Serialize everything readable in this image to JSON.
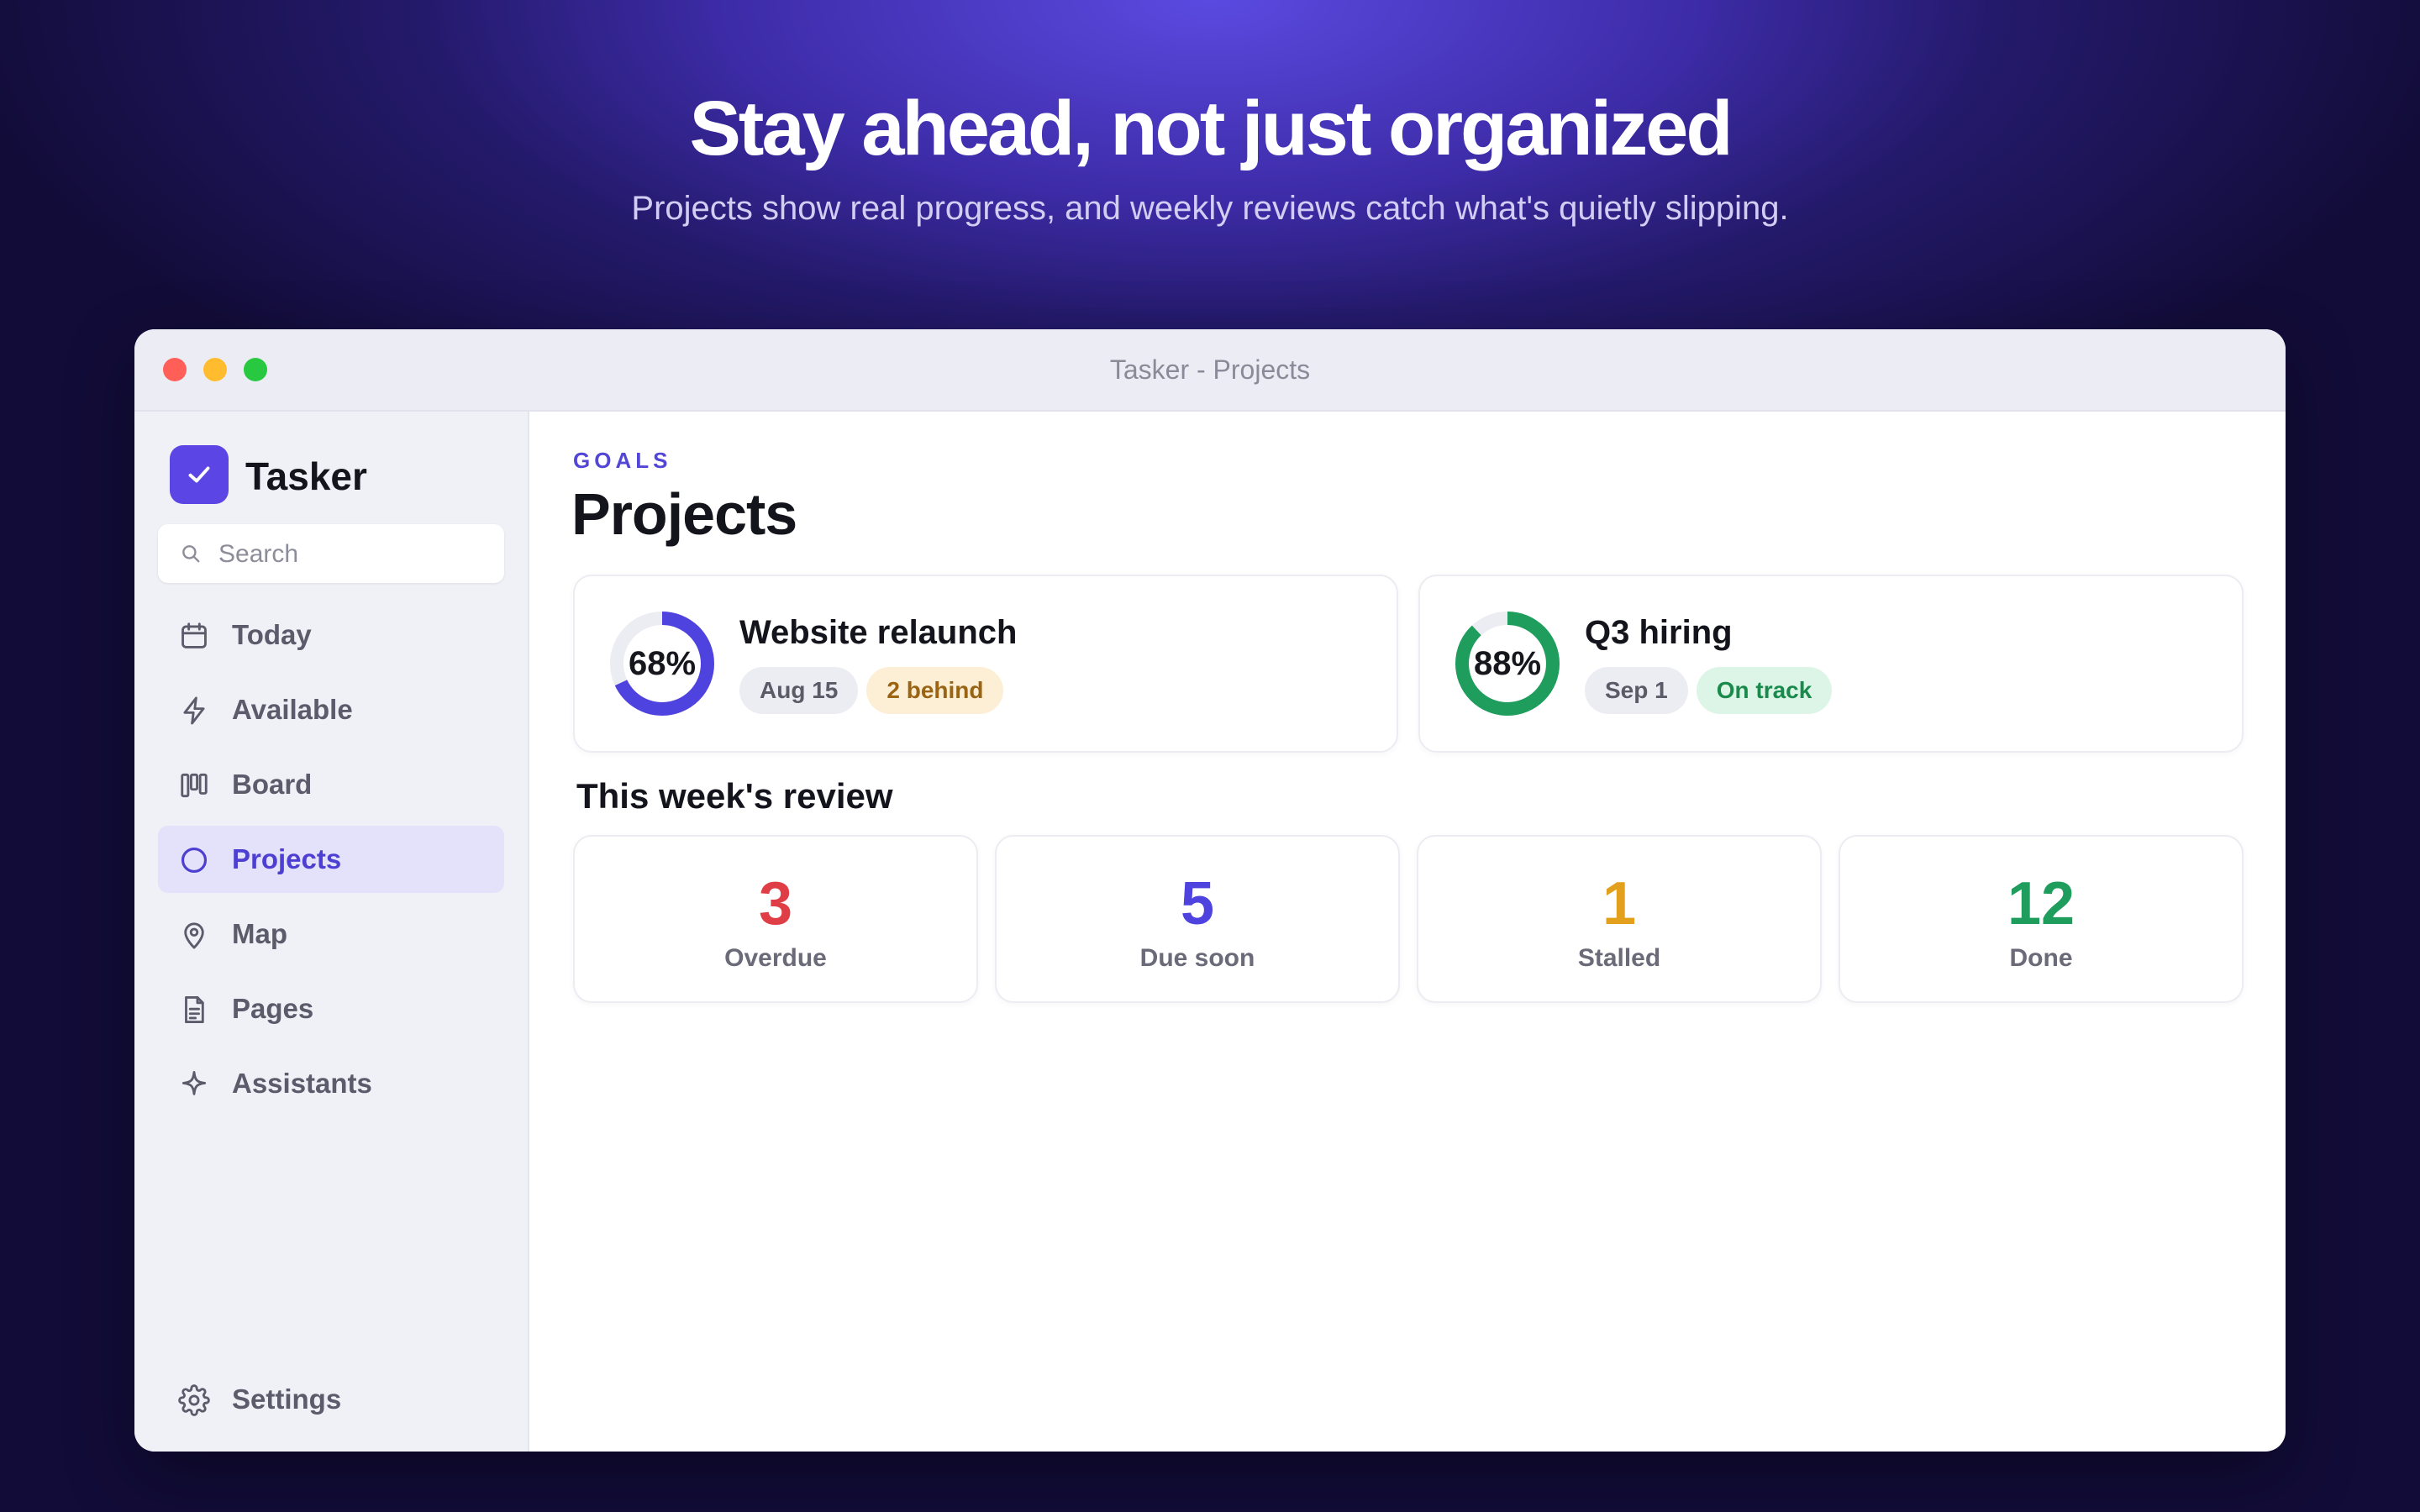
{
  "hero": {
    "title": "Stay ahead, not just organized",
    "subtitle": "Projects show real progress, and weekly reviews catch what's quietly slipping."
  },
  "window": {
    "title": "Tasker - Projects"
  },
  "sidebar": {
    "brand": "Tasker",
    "search_placeholder": "Search",
    "items": [
      {
        "label": "Today",
        "icon": "calendar-icon",
        "active": false
      },
      {
        "label": "Available",
        "icon": "lightning-icon",
        "active": false
      },
      {
        "label": "Board",
        "icon": "board-columns-icon",
        "active": false
      },
      {
        "label": "Projects",
        "icon": "circle-icon",
        "active": true
      },
      {
        "label": "Map",
        "icon": "map-pin-icon",
        "active": false
      },
      {
        "label": "Pages",
        "icon": "document-icon",
        "active": false
      },
      {
        "label": "Assistants",
        "icon": "sparkle-icon",
        "active": false
      }
    ],
    "settings_label": "Settings"
  },
  "main": {
    "eyebrow": "GOALS",
    "title": "Projects",
    "projects": [
      {
        "name": "Website relaunch",
        "progress_label": "68%",
        "progress": 0.68,
        "date": "Aug 15",
        "status": "2 behind",
        "ring_color": "#4f43e0"
      },
      {
        "name": "Q3 hiring",
        "progress_label": "88%",
        "progress": 0.88,
        "date": "Sep 1",
        "status": "On track",
        "ring_color": "#1f9d5c"
      }
    ],
    "review_title": "This week's review",
    "stats": [
      {
        "value": "3",
        "label": "Overdue",
        "color": "#e03e46"
      },
      {
        "value": "5",
        "label": "Due soon",
        "color": "#4f43e0"
      },
      {
        "value": "1",
        "label": "Stalled",
        "color": "#e3a01c"
      },
      {
        "value": "12",
        "label": "Done",
        "color": "#1f9d5c"
      }
    ]
  },
  "colors": {
    "accent": "#5b45e4",
    "active_nav_bg": "#e4e1fb",
    "behind_chip_bg": "#fcefd6",
    "on_track_chip_bg": "#dcf5e6"
  }
}
